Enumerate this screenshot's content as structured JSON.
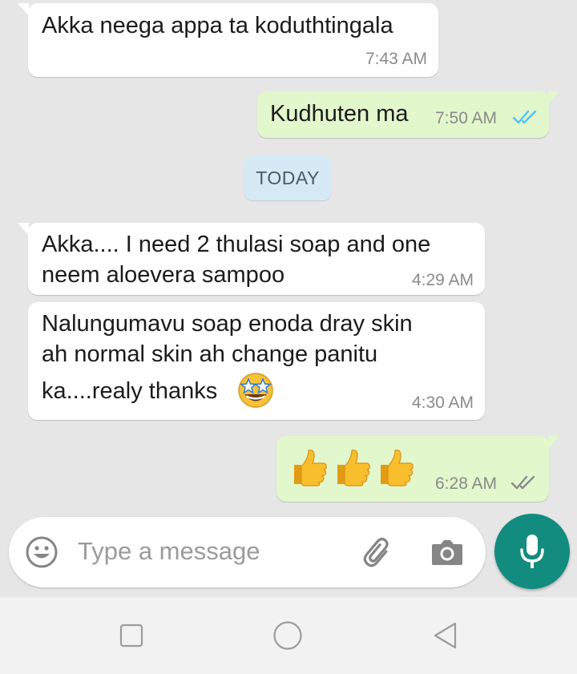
{
  "messages": [
    {
      "direction": "incoming",
      "text_lines": [
        "Akka neega appa ta koduthtingala"
      ],
      "time": "7:43 AM"
    },
    {
      "direction": "outgoing",
      "text_lines": [
        "Kudhuten ma"
      ],
      "time": "7:50 AM",
      "status": "read"
    },
    {
      "direction": "incoming",
      "text_lines": [
        "Akka.... I need 2 thulasi soap and one",
        "neem aloevera sampoo"
      ],
      "time": "4:29 AM"
    },
    {
      "direction": "incoming",
      "text_lines": [
        "Nalungumavu soap enoda dray skin",
        "ah normal skin ah change panitu",
        "ka....realy thanks"
      ],
      "time": "4:30 AM",
      "emoji": "star-struck-emoji"
    },
    {
      "direction": "outgoing",
      "emoji_count": 3,
      "emoji": "thumbs-up-emoji",
      "time": "6:28 AM",
      "status": "delivered"
    }
  ],
  "date_separator": "TODAY",
  "composer": {
    "placeholder": "Type a message",
    "left_icon": "emoji-icon",
    "right_icons": [
      "attach-icon",
      "camera-icon"
    ],
    "send_icon": "mic-icon"
  },
  "navbar": {
    "buttons": [
      "recents-icon",
      "home-icon",
      "back-icon"
    ]
  },
  "colors": {
    "chat_background": "#e6e6e6",
    "incoming_bubble": "#ffffff",
    "outgoing_bubble": "#e2f7cb",
    "read_ticks": "#4fc3f7",
    "delivered_ticks": "#8a8a8a",
    "accent": "#128c7e",
    "date_pill": "#d5eaf5"
  }
}
